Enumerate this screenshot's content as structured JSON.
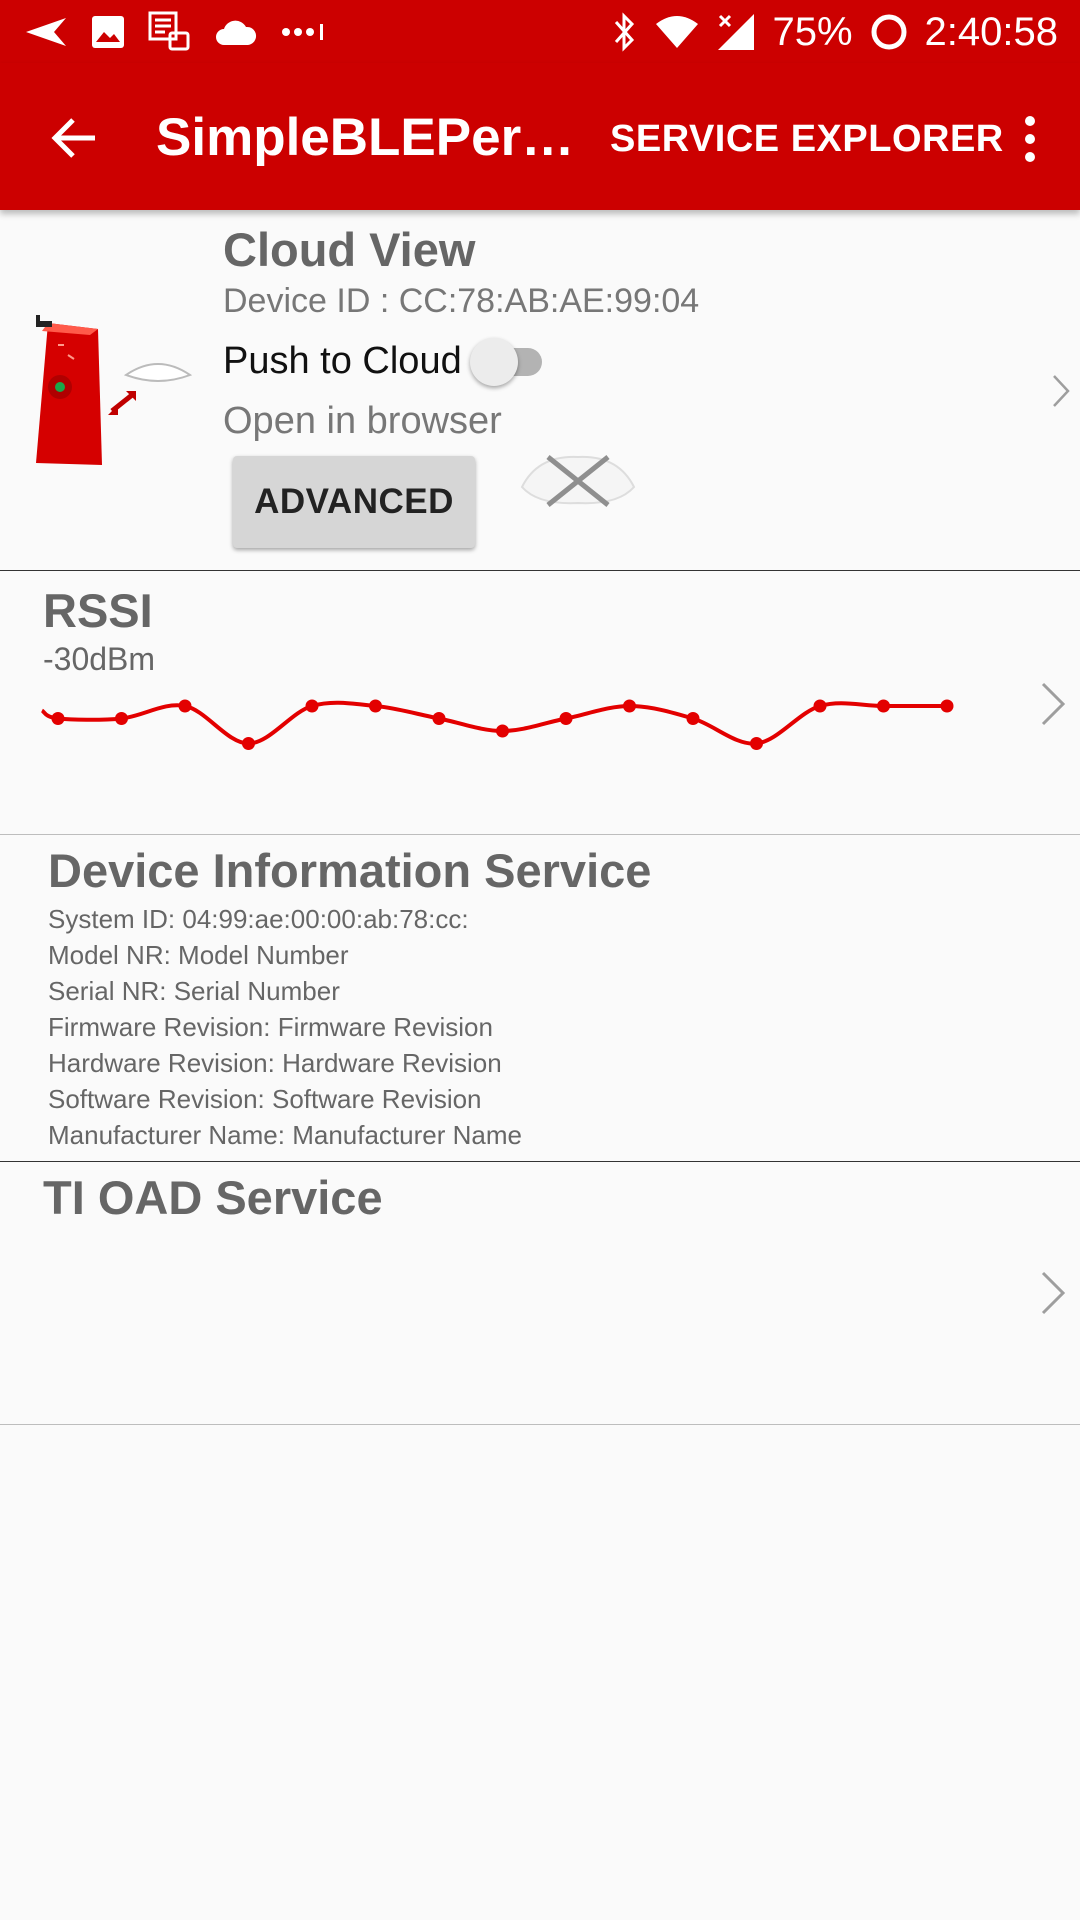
{
  "status_bar": {
    "battery": "75%",
    "time": "2:40:58",
    "left_icons": [
      "send-icon",
      "image-icon",
      "checklist-icon",
      "cloud-icon",
      "more-dots-icon"
    ],
    "right_icons": [
      "bluetooth-icon",
      "wifi-icon",
      "signal-icon",
      "battery-ring-icon"
    ]
  },
  "app_bar": {
    "title": "SimpleBLEPeri...",
    "action": "SERVICE EXPLORER",
    "back_icon": "arrow-left-icon",
    "overflow_icon": "more-vert-icon",
    "color": "#cc0000"
  },
  "cloud_view": {
    "title": "Cloud View",
    "device_id": "Device ID : CC:78:AB:AE:99:04",
    "push_label": "Push to Cloud",
    "push_enabled": false,
    "open_browser": "Open in browser",
    "advanced_button": "ADVANCED"
  },
  "rssi": {
    "title": "RSSI",
    "value": "-30dBm",
    "chart_data": {
      "type": "line",
      "series": [
        {
          "values": [
            -31,
            -31,
            -30,
            -33,
            -30,
            -30,
            -31,
            -32,
            -31,
            -30,
            -31,
            -33,
            -30,
            -30,
            -30
          ]
        }
      ],
      "ylim": [
        -36,
        -28
      ],
      "grid": false,
      "color": "#e30000"
    }
  },
  "device_info": {
    "title": "Device Information Service",
    "rows": [
      "System ID: 04:99:ae:00:00:ab:78:cc:",
      "Model NR: Model Number",
      "Serial NR: Serial Number",
      "Firmware Revision: Firmware Revision",
      "Hardware Revision: Hardware Revision",
      "Software Revision: Software Revision",
      "Manufacturer Name: Manufacturer Name"
    ]
  },
  "oad": {
    "title": "TI OAD Service"
  },
  "colors": {
    "divider": "#bdbdbd",
    "chevron": "#9e9e9e"
  }
}
